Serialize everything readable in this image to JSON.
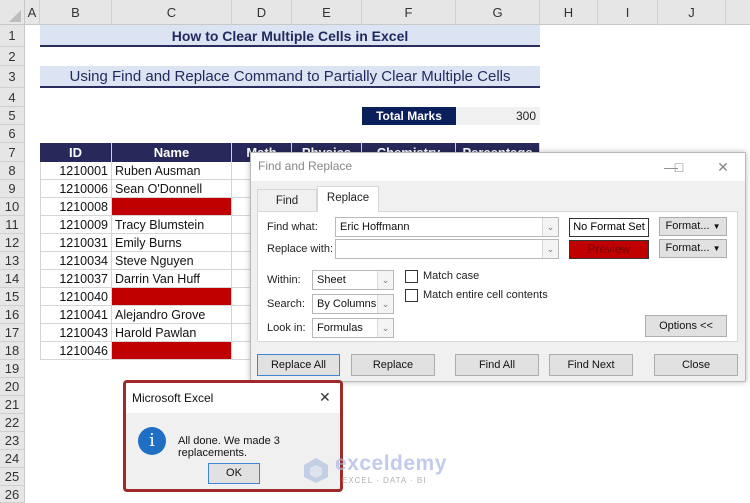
{
  "spreadsheet": {
    "columns": [
      "A",
      "B",
      "C",
      "D",
      "E",
      "F",
      "G",
      "H",
      "I",
      "J"
    ],
    "rows": [
      "1",
      "2",
      "3",
      "4",
      "5",
      "6",
      "7",
      "8",
      "9",
      "10",
      "11",
      "12",
      "13",
      "14",
      "15",
      "16",
      "17",
      "18",
      "19",
      "20",
      "21",
      "22",
      "23",
      "24",
      "25",
      "26"
    ],
    "title": "How to Clear Multiple Cells in Excel",
    "subtitle": "Using Find and Replace Command to Partially Clear Multiple Cells",
    "total_marks_label": "Total Marks",
    "total_marks_value": "300",
    "headers": [
      "ID",
      "Name",
      "Math",
      "Physics",
      "Chemistry",
      "Percentage"
    ],
    "records": [
      {
        "id": "1210001",
        "name": "Ruben Ausman",
        "highlight": false
      },
      {
        "id": "1210006",
        "name": "Sean O'Donnell",
        "highlight": false
      },
      {
        "id": "1210008",
        "name": "",
        "highlight": true
      },
      {
        "id": "1210009",
        "name": "Tracy Blumstein",
        "highlight": false
      },
      {
        "id": "1210031",
        "name": "Emily Burns",
        "highlight": false
      },
      {
        "id": "1210034",
        "name": "Steve Nguyen",
        "highlight": false
      },
      {
        "id": "1210037",
        "name": "Darrin Van Huff",
        "highlight": false
      },
      {
        "id": "1210040",
        "name": "",
        "highlight": true
      },
      {
        "id": "1210041",
        "name": "Alejandro Grove",
        "highlight": false
      },
      {
        "id": "1210043",
        "name": "Harold Pawlan",
        "highlight": false
      },
      {
        "id": "1210046",
        "name": "",
        "highlight": true
      }
    ],
    "highlight_color": "#c00000",
    "header_color": "#28285a"
  },
  "find_replace": {
    "title": "Find and Replace",
    "tabs": [
      "Find",
      "Replace"
    ],
    "active_tab": "Replace",
    "find_what_label": "Find what:",
    "find_what_value": "Eric Hoffmann",
    "replace_with_label": "Replace with:",
    "replace_with_value": "",
    "find_format_preview": "No Format Set",
    "replace_format_preview": "Preview",
    "format_button": "Format...",
    "within_label": "Within:",
    "within_value": "Sheet",
    "search_label": "Search:",
    "search_value": "By Columns",
    "lookin_label": "Look in:",
    "lookin_value": "Formulas",
    "match_case_label": "Match case",
    "match_case_checked": false,
    "match_entire_label": "Match entire cell contents",
    "match_entire_checked": false,
    "options_button": "Options <<",
    "buttons": [
      "Replace All",
      "Replace",
      "Find All",
      "Find Next",
      "Close"
    ]
  },
  "message_box": {
    "title": "Microsoft Excel",
    "message": "All done. We made 3 replacements.",
    "ok_label": "OK",
    "icon": "info-icon"
  },
  "watermark": {
    "brand": "exceldemy",
    "tagline": "EXCEL · DATA · BI"
  }
}
